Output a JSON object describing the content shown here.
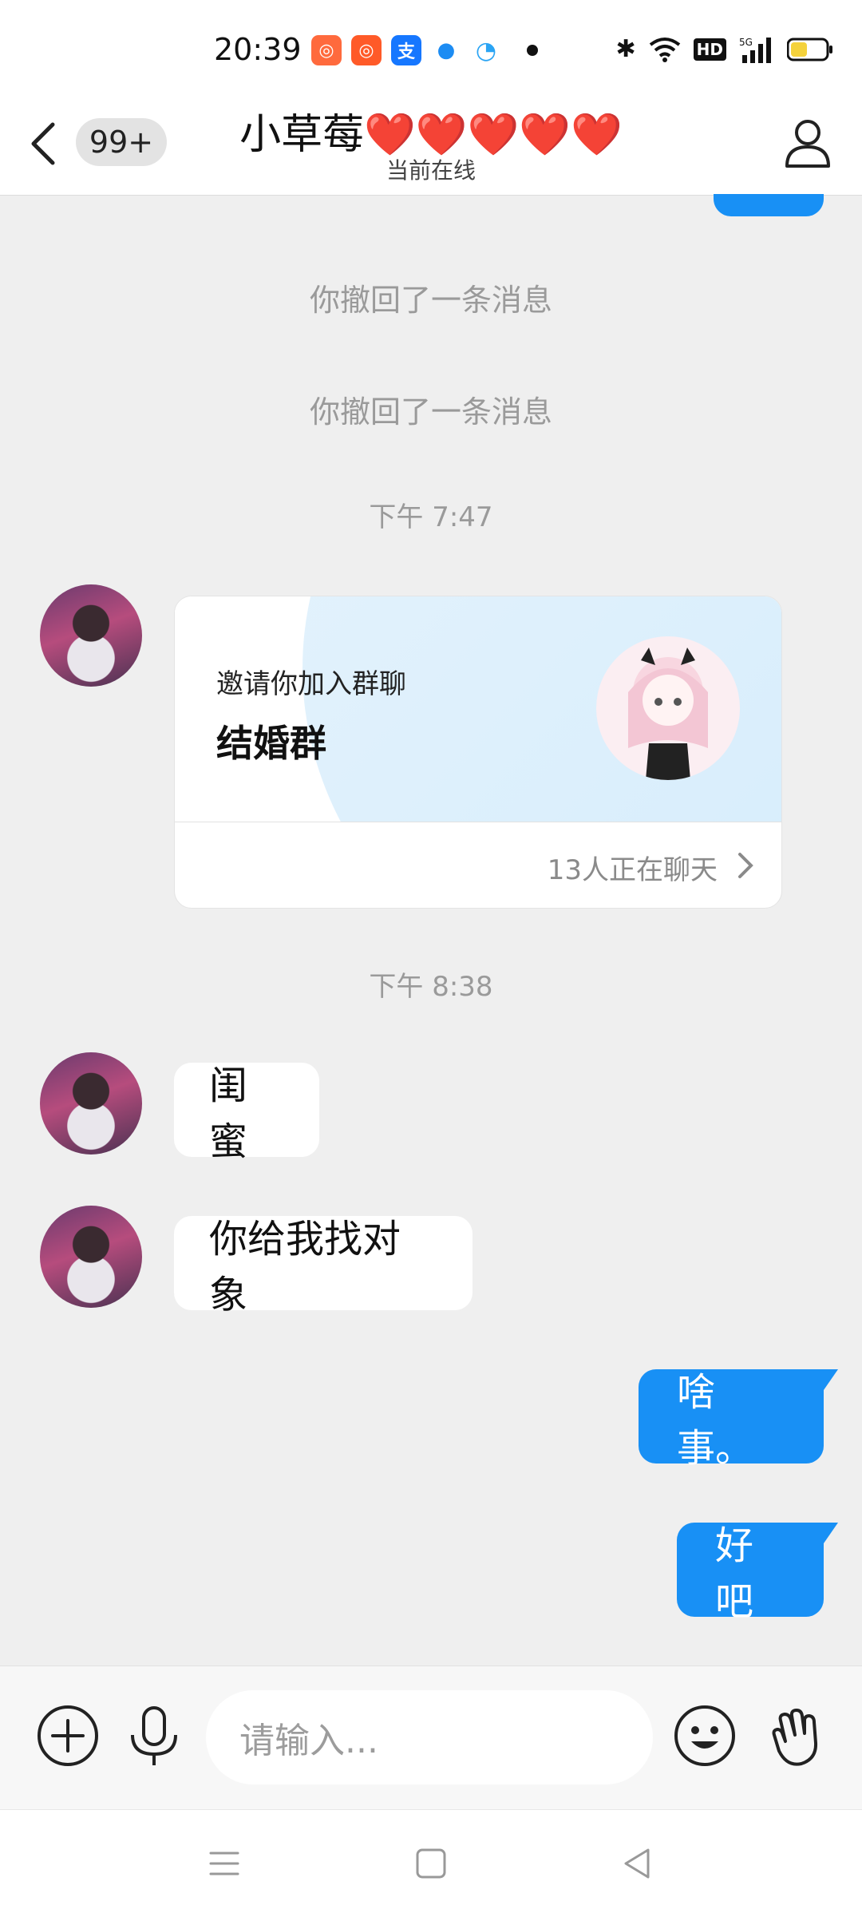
{
  "status_bar": {
    "time": "20:39",
    "icons": [
      "app-icon-1",
      "app-icon-2",
      "alipay-icon",
      "app-icon-4",
      "app-icon-5",
      "dot-icon",
      "bluetooth-icon",
      "wifi-icon",
      "hd-icon",
      "signal-5g-icon",
      "battery-icon"
    ]
  },
  "header": {
    "unread_badge": "99+",
    "contact_name": "小草莓❤️❤️❤️❤️❤️",
    "status": "当前在线"
  },
  "chat": {
    "recall_1": "你撤回了一条消息",
    "recall_2": "你撤回了一条消息",
    "time_1": "下午 7:47",
    "group_card": {
      "label": "邀请你加入群聊",
      "group_name": "结婚群",
      "member_count": "13人正在聊天"
    },
    "time_2": "下午 8:38",
    "incoming": [
      "闺蜜",
      "你给我找对象"
    ],
    "outgoing": [
      "啥事。",
      "好吧"
    ]
  },
  "input_bar": {
    "placeholder": "请输入..."
  },
  "colors": {
    "accent": "#1890f5",
    "background": "#efefef"
  }
}
